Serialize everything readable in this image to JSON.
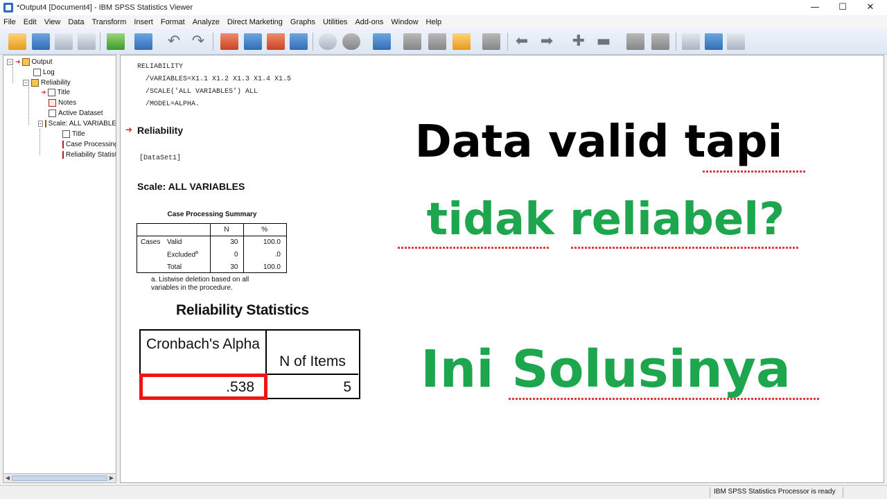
{
  "window": {
    "title": "*Output4 [Document4] - IBM SPSS Statistics Viewer",
    "controls": {
      "minimize": "—",
      "maximize": "☐",
      "close": "✕"
    }
  },
  "menu": [
    "File",
    "Edit",
    "View",
    "Data",
    "Transform",
    "Insert",
    "Format",
    "Analyze",
    "Direct Marketing",
    "Graphs",
    "Utilities",
    "Add-ons",
    "Window",
    "Help"
  ],
  "toolbar_icons": [
    "open-icon",
    "save-icon",
    "print-icon",
    "print-preview-icon",
    "export-icon",
    "recall-dialog-icon",
    "undo-icon",
    "redo-icon",
    "goto-case-icon",
    "goto-variable-icon",
    "variables-icon",
    "pivot-icon",
    "select-cases-icon",
    "weight-cases-icon",
    "insert-cases-icon",
    "promote-icon",
    "demote-icon",
    "expand-icon",
    "collapse-icon",
    "show-icon",
    "hide-icon",
    "insert-heading-icon",
    "insert-title-icon",
    "insert-text-icon"
  ],
  "outline": {
    "items": [
      {
        "label": "Output",
        "icon": "book-icon"
      },
      {
        "label": "Log",
        "icon": "log-icon"
      },
      {
        "label": "Reliability",
        "icon": "book-icon"
      },
      {
        "label": "Title",
        "icon": "title-icon"
      },
      {
        "label": "Notes",
        "icon": "notes-icon"
      },
      {
        "label": "Active Dataset",
        "icon": "dataset-icon"
      },
      {
        "label": "Scale: ALL VARIABLES",
        "icon": "book-icon"
      },
      {
        "label": "Title",
        "icon": "title-icon"
      },
      {
        "label": "Case Processing Summary",
        "icon": "table-icon"
      },
      {
        "label": "Reliability Statistics",
        "icon": "table-icon"
      }
    ]
  },
  "syntax": "RELIABILITY\n  /VARIABLES=X1.1 X1.2 X1.3 X1.4 X1.5\n  /SCALE('ALL VARIABLES') ALL\n  /MODEL=ALPHA.",
  "output": {
    "reliability_heading": "Reliability",
    "dataset": "[DataSet1]",
    "scale_title": "Scale: ALL VARIABLES",
    "case_processing": {
      "title": "Case Processing Summary",
      "headers": [
        "N",
        "%"
      ],
      "group_label": "Cases",
      "rows": [
        {
          "label": "Valid",
          "sup": "",
          "n": "30",
          "pct": "100.0"
        },
        {
          "label": "Excluded",
          "sup": "a",
          "n": "0",
          "pct": ".0"
        },
        {
          "label": "Total",
          "sup": "",
          "n": "30",
          "pct": "100.0"
        }
      ],
      "footnote": "a. Listwise deletion based on all variables in the procedure."
    },
    "reliability_statistics": {
      "title": "Reliability Statistics",
      "header_alpha": "Cronbach's Alpha",
      "header_items": "N of Items",
      "alpha": ".538",
      "items": "5"
    }
  },
  "overlay": {
    "line1": "Data valid tapi",
    "line2": "tidak reliabel?",
    "line3": "Ini Solusinya",
    "color_black": "#000000",
    "color_green": "#1ea64e",
    "highlight_color": "#ee1515"
  },
  "status": "IBM SPSS Statistics Processor is ready"
}
